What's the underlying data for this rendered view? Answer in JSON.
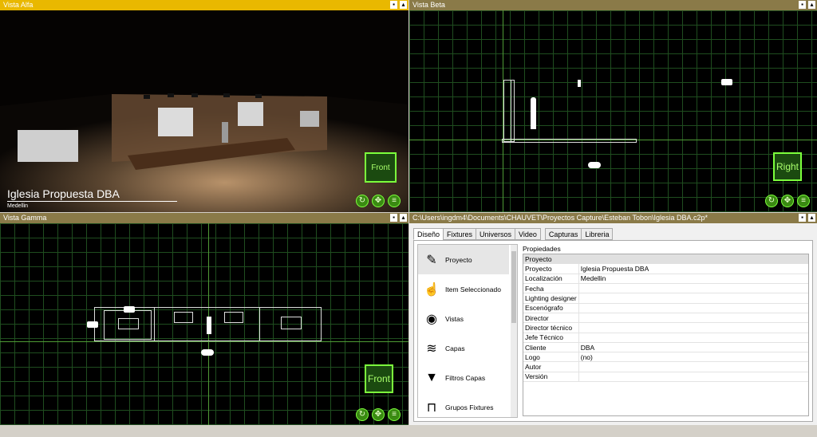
{
  "views": {
    "alfa": {
      "title": "Vista Alfa",
      "project_name": "Iglesia Propuesta DBA",
      "city": "Medellin",
      "cube_label": "Front"
    },
    "beta": {
      "title": "Vista Beta",
      "cube_label": "Right"
    },
    "gamma": {
      "title": "Vista Gamma",
      "cube_label": "Front"
    }
  },
  "editor": {
    "path": "C:\\Users\\ingdm4\\Documents\\CHAUVET\\Proyectos Capture\\Esteban Tobon\\Iglesia DBA.c2p*",
    "tabs": [
      "Diseño",
      "Fixtures",
      "Universos",
      "Video",
      "Capturas",
      "Libreria"
    ],
    "sidebar": [
      {
        "label": "Proyecto",
        "icon": "edit-document-icon"
      },
      {
        "label": "Item Seleccionado",
        "icon": "select-pointer-icon"
      },
      {
        "label": "Vistas",
        "icon": "eye-icon"
      },
      {
        "label": "Capas",
        "icon": "layers-icon"
      },
      {
        "label": "Filtros Capas",
        "icon": "filter-icon"
      },
      {
        "label": "Grupos Fixtures",
        "icon": "fixture-group-icon"
      }
    ],
    "properties_title": "Propiedades",
    "properties_header": "Proyecto",
    "properties": [
      {
        "key": "Proyecto",
        "value": "Iglesia Propuesta DBA"
      },
      {
        "key": "Localización",
        "value": "Medellin"
      },
      {
        "key": "Fecha",
        "value": ""
      },
      {
        "key": "Lighting designer",
        "value": ""
      },
      {
        "key": "Escenógrafo",
        "value": ""
      },
      {
        "key": "Director",
        "value": ""
      },
      {
        "key": "Director técnico",
        "value": ""
      },
      {
        "key": "Jefe Técnico",
        "value": ""
      },
      {
        "key": "Cliente",
        "value": "DBA"
      },
      {
        "key": "Logo",
        "value": "(no)"
      },
      {
        "key": "Autor",
        "value": ""
      },
      {
        "key": "Versión",
        "value": ""
      }
    ]
  },
  "colors": {
    "titlebar_active": "#e9b800",
    "titlebar_inactive": "#8a7a48",
    "grid_axis": "#4f9a35",
    "cube_green": "#7cff3c"
  }
}
